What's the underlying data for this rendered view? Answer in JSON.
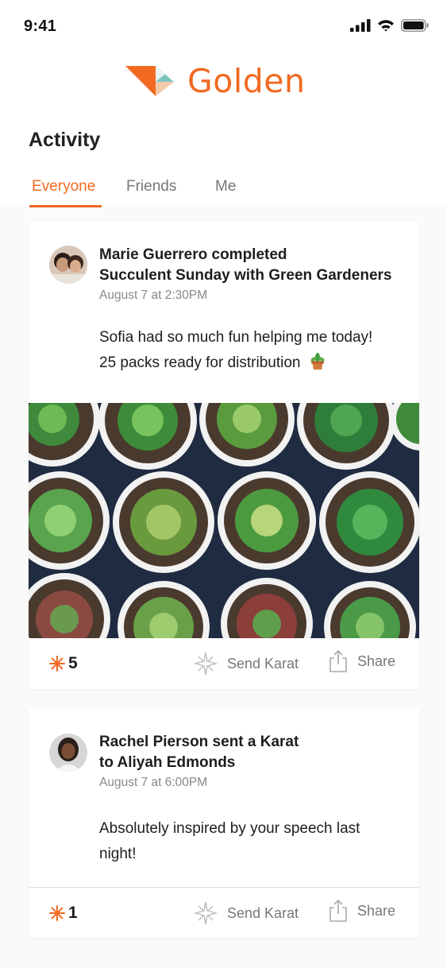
{
  "status_bar": {
    "time": "9:41"
  },
  "brand": {
    "name": "Golden",
    "accent_color": "#f26a22"
  },
  "page": {
    "title": "Activity"
  },
  "tabs": [
    {
      "label": "Everyone",
      "active": true
    },
    {
      "label": "Friends",
      "active": false
    },
    {
      "label": "Me",
      "active": false
    }
  ],
  "feed": [
    {
      "headline_line1": "Marie Guerrero completed",
      "headline_line2": "Succulent Sunday with Green Gardeners",
      "timestamp": "August 7 at 2:30PM",
      "message_line1": "Sofia had so much fun helping me today!",
      "message_line2": "25 packs ready for distribution",
      "karat_count": "5",
      "send_karat_label": "Send Karat",
      "share_label": "Share"
    },
    {
      "headline_line1": "Rachel Pierson sent a Karat",
      "headline_line2": "to Aliyah Edmonds",
      "timestamp": "August 7 at 6:00PM",
      "message_line1": "Absolutely inspired by your speech last",
      "message_line2": "night!",
      "karat_count": "1",
      "send_karat_label": "Send Karat",
      "share_label": "Share"
    }
  ]
}
